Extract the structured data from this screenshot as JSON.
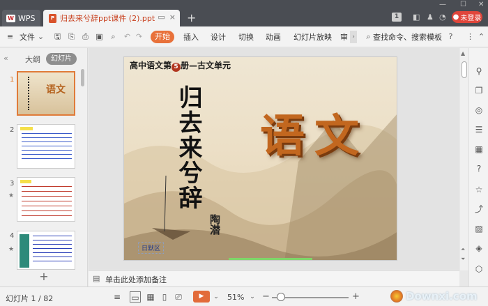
{
  "titlebar": {
    "app_tab": "WPS",
    "doc_tab_title": "归去来兮辞ppt课件 (2).ppt",
    "new_tab": "+",
    "badge": "1",
    "login_label": "未登录"
  },
  "menubar": {
    "file": "文件",
    "items": [
      "开始",
      "插入",
      "设计",
      "切换",
      "动画",
      "幻灯片放映",
      "审"
    ],
    "search": "查找命令、搜索模板"
  },
  "leftpanel": {
    "collapse": "«",
    "tab_outline": "大纲",
    "tab_slides": "幻灯片",
    "slide_numbers": [
      "1",
      "2",
      "3",
      "4"
    ],
    "add": "+"
  },
  "slide": {
    "header_pre": "高中语文第",
    "header_num": "5",
    "header_post": "册—古文单元",
    "title": "归去来兮辞",
    "author": "陶潜",
    "subject": "语文",
    "school": "日默区"
  },
  "notes": {
    "placeholder": "单击此处添加备注"
  },
  "statusbar": {
    "slide_counter": "幻灯片 1 / 82",
    "zoom": "51%",
    "zoom_level_percent": 51,
    "zoom_minus": "−",
    "zoom_plus": "+"
  },
  "watermark": "Downxi.com"
}
